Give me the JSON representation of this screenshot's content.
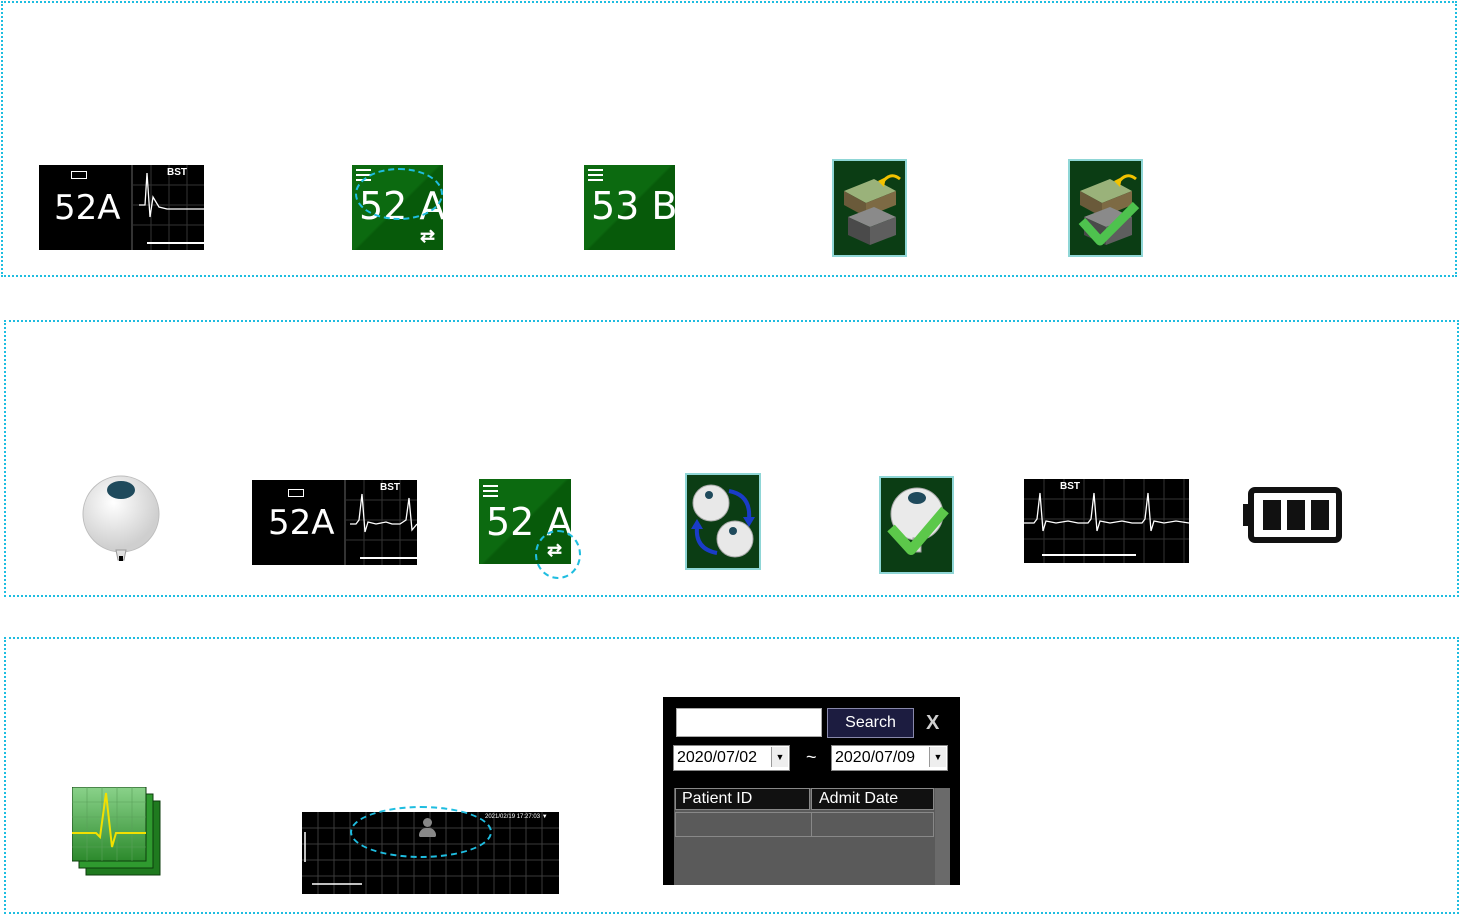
{
  "panel_top": {
    "monitor_tile": {
      "bed": "52A",
      "wave_label": "BST"
    },
    "bed_tile_a": {
      "bed": "52 A"
    },
    "bed_tile_b": {
      "bed": "53 B"
    },
    "icons": [
      "bed-transfer-icon",
      "bed-transfer-confirmed-icon"
    ]
  },
  "panel_middle": {
    "sensor_icon": "patch-sensor-icon",
    "monitor_tile": {
      "bed": "52A",
      "wave_label": "BST"
    },
    "bed_tile": {
      "bed": "52 A"
    },
    "icons": [
      "sensor-swap-icon",
      "sensor-confirmed-icon",
      "battery-icon"
    ],
    "ecg_strip_label": "BST"
  },
  "panel_bottom": {
    "ecg_stack_icon": "ecg-history-icon",
    "monitor_strip": {
      "timestamp": "2021/02/19 17:27:03 ▼"
    },
    "search_dialog": {
      "search_button": "Search",
      "close_label": "X",
      "date_from": "2020/07/02",
      "date_separator": "~",
      "date_to": "2020/07/09",
      "columns": [
        "Patient ID",
        "Admit Date"
      ]
    }
  },
  "colors": {
    "panel_border": "#1fbde0",
    "tile_green": "#0c6a10",
    "dialog_button": "#1c1c40"
  }
}
